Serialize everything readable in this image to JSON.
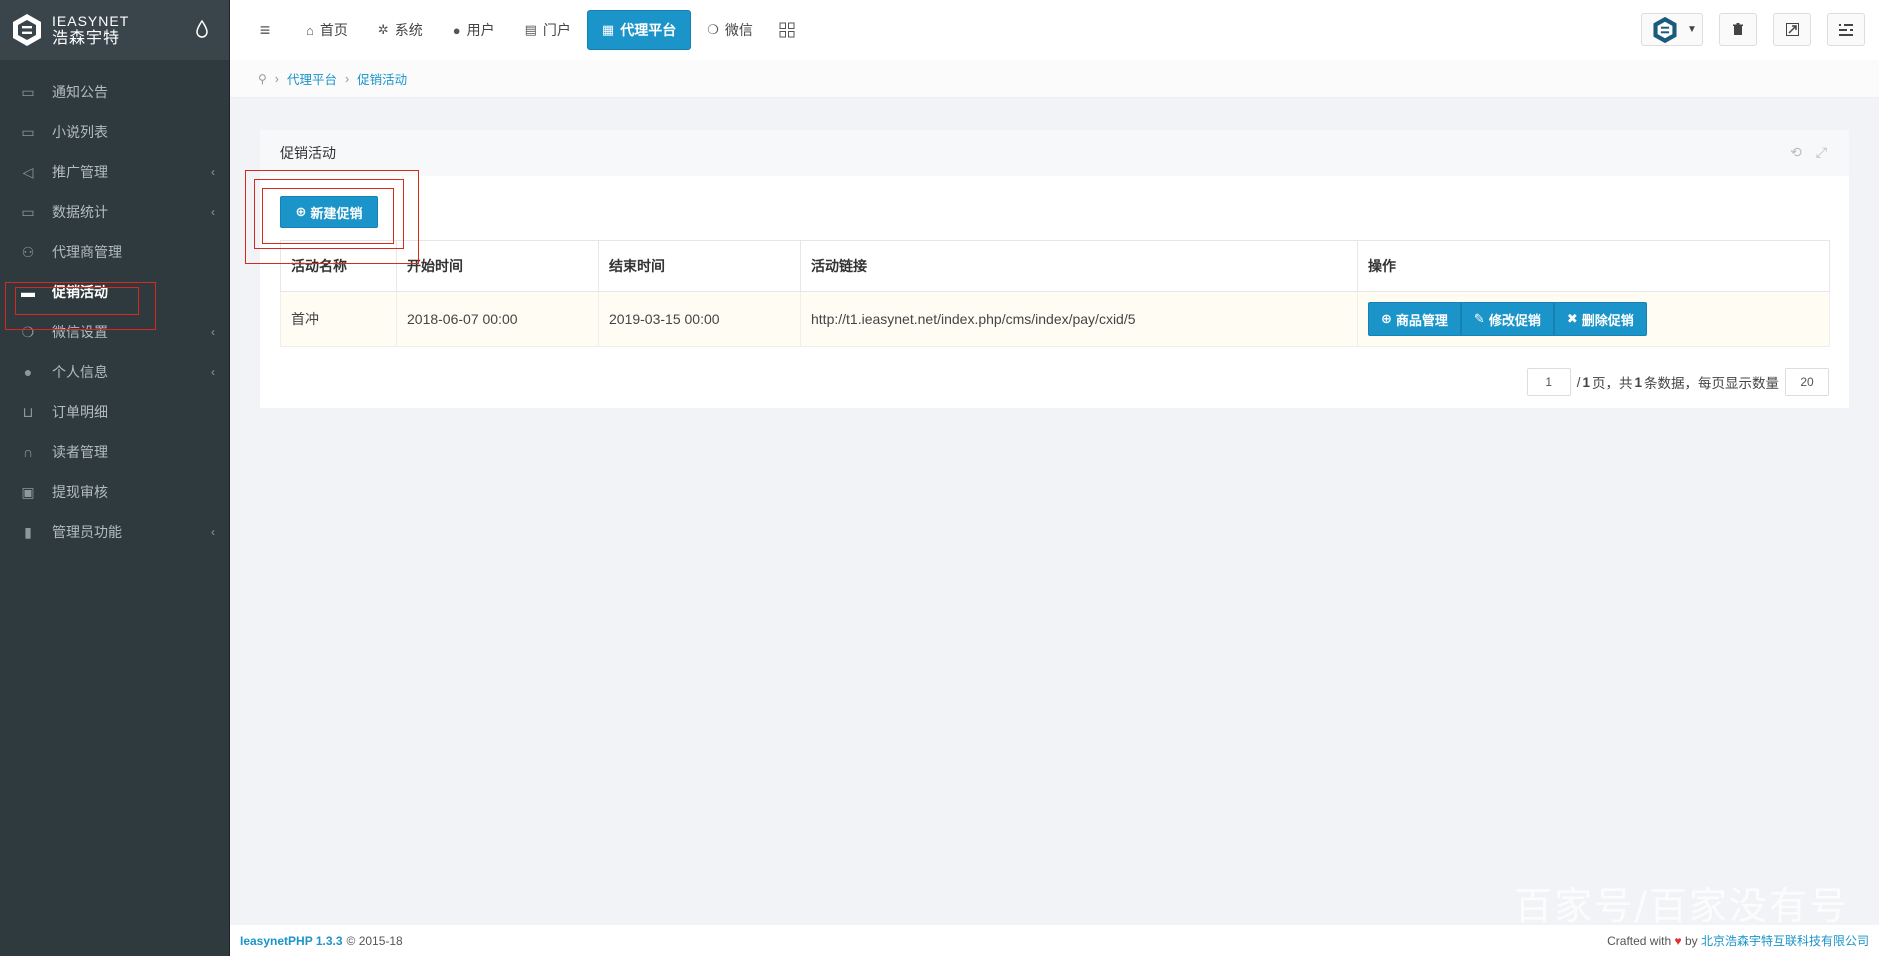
{
  "brand": {
    "en": "IEASYNET",
    "cn": "浩森宇特"
  },
  "sidebar": {
    "items": [
      {
        "label": "通知公告",
        "icon": "folder-icon",
        "has_arrow": false
      },
      {
        "label": "小说列表",
        "icon": "folder-icon",
        "has_arrow": false
      },
      {
        "label": "推广管理",
        "icon": "bullhorn-icon",
        "has_arrow": true
      },
      {
        "label": "数据统计",
        "icon": "folder-icon",
        "has_arrow": true
      },
      {
        "label": "代理商管理",
        "icon": "users-icon",
        "has_arrow": false
      },
      {
        "label": "促销活动",
        "icon": "coffee-icon",
        "has_arrow": false,
        "active": true
      },
      {
        "label": "微信设置",
        "icon": "wechat-icon",
        "has_arrow": true
      },
      {
        "label": "个人信息",
        "icon": "user-icon",
        "has_arrow": true
      },
      {
        "label": "订单明细",
        "icon": "cart-icon",
        "has_arrow": false
      },
      {
        "label": "读者管理",
        "icon": "headphones-icon",
        "has_arrow": false
      },
      {
        "label": "提现审核",
        "icon": "money-icon",
        "has_arrow": false
      },
      {
        "label": "管理员功能",
        "icon": "lock-icon",
        "has_arrow": true
      }
    ]
  },
  "topnav": {
    "items": [
      {
        "label": "首页",
        "icon": "home-icon"
      },
      {
        "label": "系统",
        "icon": "gear-icon"
      },
      {
        "label": "用户",
        "icon": "user-icon"
      },
      {
        "label": "门户",
        "icon": "newspaper-icon"
      },
      {
        "label": "代理平台",
        "icon": "list-alt-icon",
        "active": true
      },
      {
        "label": "微信",
        "icon": "wechat-icon"
      }
    ]
  },
  "breadcrumb": {
    "items": [
      "代理平台",
      "促销活动"
    ]
  },
  "panel": {
    "title": "促销活动",
    "new_button": "新建促销"
  },
  "table": {
    "headers": [
      "活动名称",
      "开始时间",
      "结束时间",
      "活动链接",
      "操作"
    ],
    "rows": [
      {
        "name": "首冲",
        "start": "2018-06-07 00:00",
        "end": "2019-03-15 00:00",
        "link": "http://t1.ieasynet.net/index.php/cms/index/pay/cxid/5",
        "ops": [
          "商品管理",
          "修改促销",
          "删除促销"
        ]
      }
    ]
  },
  "pager": {
    "current_page": "1",
    "text_total_pages_prefix": "/ ",
    "total_pages": "1",
    "text_after_pages": " 页，共 ",
    "total_records": "1",
    "text_after_records": " 条数据，每页显示数量",
    "page_size": "20"
  },
  "footer": {
    "version": "IeasynetPHP 1.3.3",
    "copyright": "© 2015-18",
    "crafted": "Crafted with",
    "by": "by",
    "company": "北京浩森宇特互联科技有限公司"
  },
  "watermark": "百家号/百家没有号",
  "colors": {
    "accent": "#1a94c9",
    "sidebar": "#2f3a3f",
    "highlight": "#d9281c"
  }
}
